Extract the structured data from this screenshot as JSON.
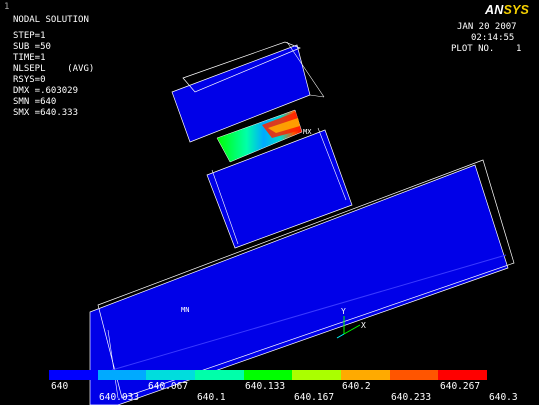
{
  "window_number": "1",
  "info": {
    "title": "NODAL SOLUTION",
    "lines": [
      "STEP=1",
      "SUB =50",
      "TIME=1",
      "NLSEPL    (AVG)",
      "RSYS=0",
      "DMX =.603029",
      "SMN =640",
      "SMX =640.333"
    ]
  },
  "header_right": {
    "date": "JAN 20 2007",
    "time": "02:14:55",
    "plot_no": "PLOT NO.    1"
  },
  "logo": {
    "an": "AN",
    "sys": "SYS"
  },
  "markers": {
    "min_label": "MN",
    "max_label": "MX",
    "axis_y": "Y",
    "axis_x": "X"
  },
  "legend": {
    "colors": [
      "#0000ff",
      "#00aaff",
      "#00dddd",
      "#00ffaa",
      "#00ff00",
      "#aaff00",
      "#ffaa00",
      "#ff5500",
      "#ff0000"
    ],
    "upper_labels": [
      "640",
      "640.067",
      "640.133",
      "640.2",
      "640.267"
    ],
    "lower_labels": [
      "640.033",
      "640.1",
      "640.167",
      "640.233",
      "640.3"
    ]
  }
}
